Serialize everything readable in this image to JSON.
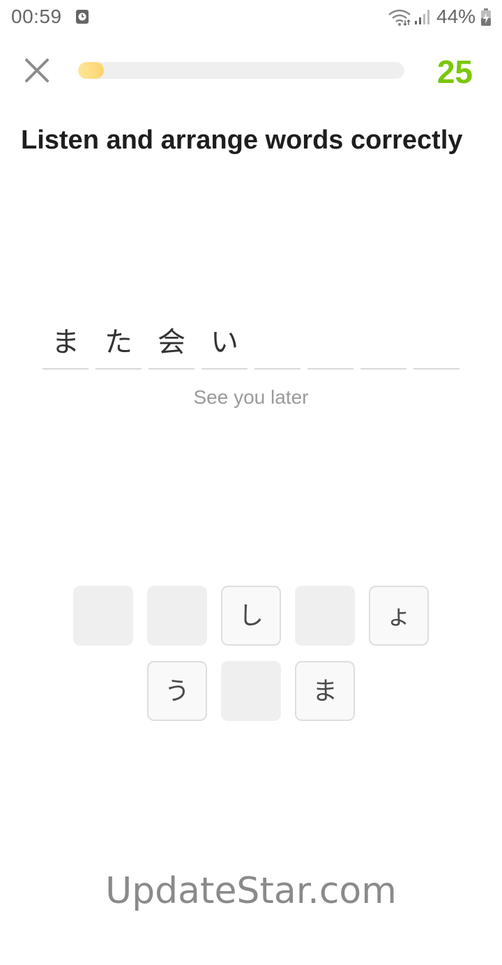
{
  "status_bar": {
    "time": "00:59",
    "battery": "44%",
    "icons": [
      "alarm-icon",
      "wifi-icon",
      "signal-icon",
      "battery-charging-icon"
    ]
  },
  "header": {
    "close_icon": "close-icon",
    "progress": 0.08,
    "score": "25",
    "colors": {
      "score": "#7ac70c",
      "progress_fill": "#fbd36f",
      "progress_track": "#efefef"
    }
  },
  "exercise": {
    "title": "Listen and arrange words correctly",
    "slots": [
      "ま",
      "た",
      "会",
      "い",
      "",
      "",
      "",
      ""
    ],
    "translation": "See you later"
  },
  "word_bank": {
    "row1": [
      {
        "text": "",
        "used": true
      },
      {
        "text": "",
        "used": true
      },
      {
        "text": "し",
        "used": false
      },
      {
        "text": "",
        "used": true
      },
      {
        "text": "ょ",
        "used": false
      }
    ],
    "row2": [
      {
        "text": "う",
        "used": false
      },
      {
        "text": "",
        "used": true
      },
      {
        "text": "ま",
        "used": false
      }
    ]
  },
  "watermark": "UpdateStar.com"
}
